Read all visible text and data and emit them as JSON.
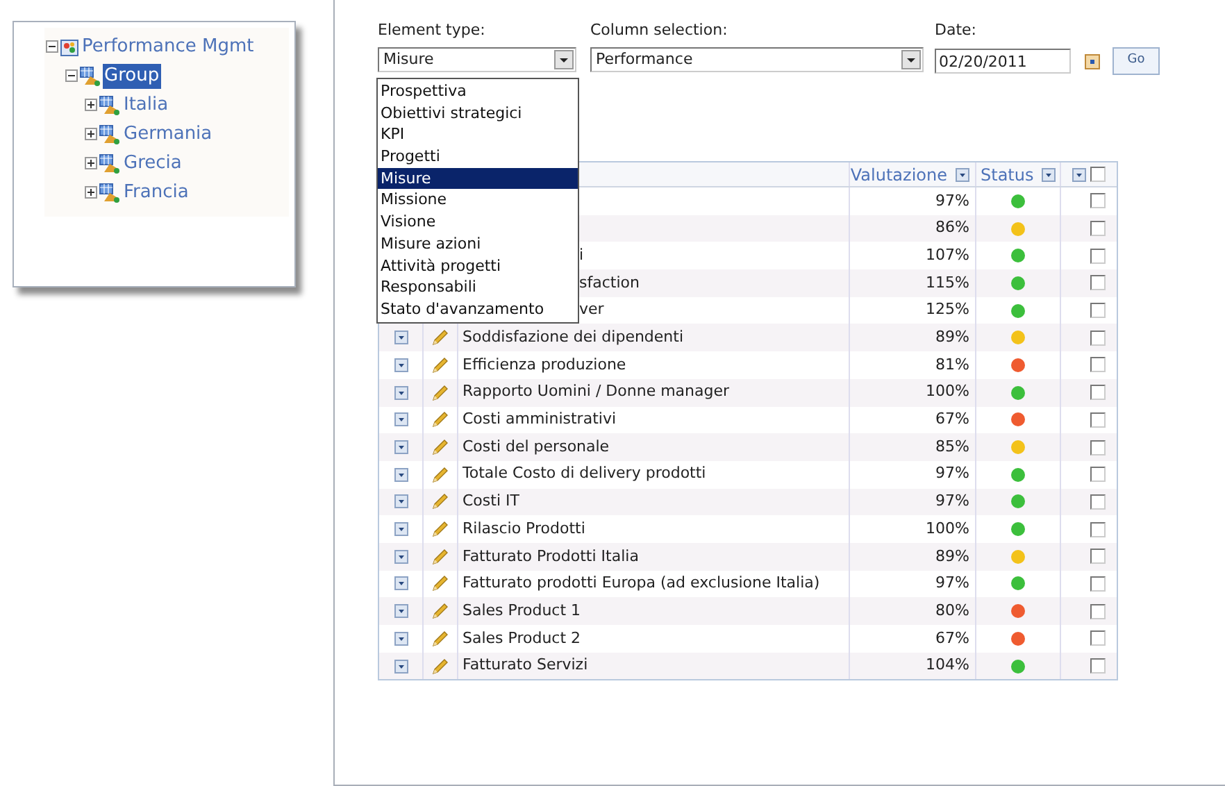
{
  "tree": {
    "label": "Performance Mgmt",
    "expanded": true,
    "children": [
      {
        "label": "Group",
        "selected": true,
        "expanded": true,
        "children": [
          {
            "label": "Italia",
            "selected": false,
            "expanded": false
          },
          {
            "label": "Germania",
            "selected": false,
            "expanded": false
          },
          {
            "label": "Grecia",
            "selected": false,
            "expanded": false
          },
          {
            "label": "Francia",
            "selected": false,
            "expanded": false
          }
        ]
      }
    ]
  },
  "filters": {
    "element_type": {
      "label": "Element type:",
      "value": "Misure"
    },
    "column_selection": {
      "label": "Column selection:",
      "value": "Performance"
    },
    "date": {
      "label": "Date:",
      "value": "02/20/2011"
    },
    "go_button": "Go"
  },
  "dropdown": {
    "options": [
      {
        "label": "Prospettiva",
        "selected": false
      },
      {
        "label": "Obiettivi strategici",
        "selected": false
      },
      {
        "label": "KPI",
        "selected": false
      },
      {
        "label": "Progetti",
        "selected": false
      },
      {
        "label": "Misure",
        "selected": true
      },
      {
        "label": "Missione",
        "selected": false
      },
      {
        "label": "Visione",
        "selected": false
      },
      {
        "label": "Misure azioni",
        "selected": false
      },
      {
        "label": "Attività progetti",
        "selected": false
      },
      {
        "label": "Responsabili",
        "selected": false
      },
      {
        "label": "Stato d'avanzamento",
        "selected": false
      }
    ]
  },
  "table": {
    "columns": [
      "Valutazione",
      "Status"
    ],
    "header_checked": false,
    "rows": [
      {
        "value": "97%",
        "color": "#3cbf3c",
        "checked": false
      },
      {
        "value": "86%",
        "color": "#f3c21a",
        "checked": false
      },
      {
        "covered": true,
        "name": "i",
        "value": "107%",
        "color": "#3cbf3c",
        "checked": false
      },
      {
        "covered": true,
        "name": "sfaction",
        "value": "115%",
        "color": "#3cbf3c",
        "checked": false
      },
      {
        "covered": true,
        "name": "ver",
        "value": "125%",
        "color": "#3cbf3c",
        "checked": false
      },
      {
        "covered": false,
        "name": "Soddisfazione dei dipendenti",
        "value": "89%",
        "color": "#f3c21a",
        "checked": false
      },
      {
        "covered": false,
        "name": "Efficienza produzione",
        "value": "81%",
        "color": "#ef5b30",
        "checked": false
      },
      {
        "covered": false,
        "name": "Rapporto Uomini / Donne manager",
        "value": "100%",
        "color": "#3cbf3c",
        "checked": false
      },
      {
        "covered": false,
        "name": "Costi amministrativi",
        "value": "67%",
        "color": "#ef5b30",
        "checked": false
      },
      {
        "covered": false,
        "name": "Costi del personale",
        "value": "85%",
        "color": "#f3c21a",
        "checked": false
      },
      {
        "covered": false,
        "name": "Totale Costo di delivery prodotti",
        "value": "97%",
        "color": "#3cbf3c",
        "checked": false
      },
      {
        "covered": false,
        "name": "Costi IT",
        "value": "97%",
        "color": "#3cbf3c",
        "checked": false
      },
      {
        "covered": false,
        "name": "Rilascio Prodotti",
        "value": "100%",
        "color": "#3cbf3c",
        "checked": false
      },
      {
        "covered": false,
        "name": "Fatturato Prodotti Italia",
        "value": "89%",
        "color": "#f3c21a",
        "checked": false
      },
      {
        "covered": false,
        "name": "Fatturato prodotti Europa (ad exclusione Italia)",
        "value": "97%",
        "color": "#3cbf3c",
        "checked": false
      },
      {
        "covered": false,
        "name": "Sales Product 1",
        "value": "80%",
        "color": "#ef5b30",
        "checked": false
      },
      {
        "covered": false,
        "name": "Sales Product 2",
        "value": "67%",
        "color": "#ef5b30",
        "checked": false
      },
      {
        "covered": false,
        "name": "Fatturato Servizi",
        "value": "104%",
        "color": "#3cbf3c",
        "checked": false
      }
    ]
  }
}
